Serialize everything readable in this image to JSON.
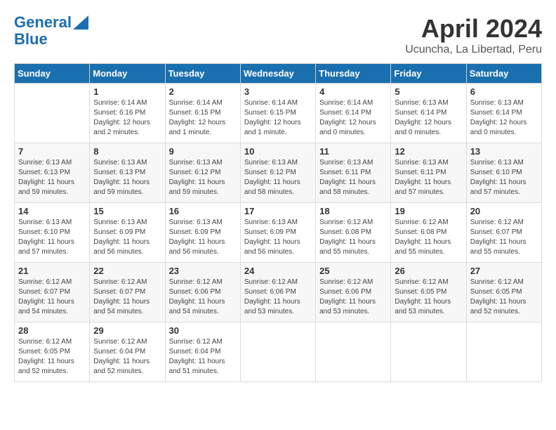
{
  "header": {
    "logo_line1": "General",
    "logo_line2": "Blue",
    "month_title": "April 2024",
    "subtitle": "Ucuncha, La Libertad, Peru"
  },
  "days_of_week": [
    "Sunday",
    "Monday",
    "Tuesday",
    "Wednesday",
    "Thursday",
    "Friday",
    "Saturday"
  ],
  "weeks": [
    [
      {
        "day": "",
        "info": ""
      },
      {
        "day": "1",
        "info": "Sunrise: 6:14 AM\nSunset: 6:16 PM\nDaylight: 12 hours\nand 2 minutes."
      },
      {
        "day": "2",
        "info": "Sunrise: 6:14 AM\nSunset: 6:15 PM\nDaylight: 12 hours\nand 1 minute."
      },
      {
        "day": "3",
        "info": "Sunrise: 6:14 AM\nSunset: 6:15 PM\nDaylight: 12 hours\nand 1 minute."
      },
      {
        "day": "4",
        "info": "Sunrise: 6:14 AM\nSunset: 6:14 PM\nDaylight: 12 hours\nand 0 minutes."
      },
      {
        "day": "5",
        "info": "Sunrise: 6:13 AM\nSunset: 6:14 PM\nDaylight: 12 hours\nand 0 minutes."
      },
      {
        "day": "6",
        "info": "Sunrise: 6:13 AM\nSunset: 6:14 PM\nDaylight: 12 hours\nand 0 minutes."
      }
    ],
    [
      {
        "day": "7",
        "info": "Sunrise: 6:13 AM\nSunset: 6:13 PM\nDaylight: 11 hours\nand 59 minutes."
      },
      {
        "day": "8",
        "info": "Sunrise: 6:13 AM\nSunset: 6:13 PM\nDaylight: 11 hours\nand 59 minutes."
      },
      {
        "day": "9",
        "info": "Sunrise: 6:13 AM\nSunset: 6:12 PM\nDaylight: 11 hours\nand 59 minutes."
      },
      {
        "day": "10",
        "info": "Sunrise: 6:13 AM\nSunset: 6:12 PM\nDaylight: 11 hours\nand 58 minutes."
      },
      {
        "day": "11",
        "info": "Sunrise: 6:13 AM\nSunset: 6:11 PM\nDaylight: 11 hours\nand 58 minutes."
      },
      {
        "day": "12",
        "info": "Sunrise: 6:13 AM\nSunset: 6:11 PM\nDaylight: 11 hours\nand 57 minutes."
      },
      {
        "day": "13",
        "info": "Sunrise: 6:13 AM\nSunset: 6:10 PM\nDaylight: 11 hours\nand 57 minutes."
      }
    ],
    [
      {
        "day": "14",
        "info": "Sunrise: 6:13 AM\nSunset: 6:10 PM\nDaylight: 11 hours\nand 57 minutes."
      },
      {
        "day": "15",
        "info": "Sunrise: 6:13 AM\nSunset: 6:09 PM\nDaylight: 11 hours\nand 56 minutes."
      },
      {
        "day": "16",
        "info": "Sunrise: 6:13 AM\nSunset: 6:09 PM\nDaylight: 11 hours\nand 56 minutes."
      },
      {
        "day": "17",
        "info": "Sunrise: 6:13 AM\nSunset: 6:09 PM\nDaylight: 11 hours\nand 56 minutes."
      },
      {
        "day": "18",
        "info": "Sunrise: 6:12 AM\nSunset: 6:08 PM\nDaylight: 11 hours\nand 55 minutes."
      },
      {
        "day": "19",
        "info": "Sunrise: 6:12 AM\nSunset: 6:08 PM\nDaylight: 11 hours\nand 55 minutes."
      },
      {
        "day": "20",
        "info": "Sunrise: 6:12 AM\nSunset: 6:07 PM\nDaylight: 11 hours\nand 55 minutes."
      }
    ],
    [
      {
        "day": "21",
        "info": "Sunrise: 6:12 AM\nSunset: 6:07 PM\nDaylight: 11 hours\nand 54 minutes."
      },
      {
        "day": "22",
        "info": "Sunrise: 6:12 AM\nSunset: 6:07 PM\nDaylight: 11 hours\nand 54 minutes."
      },
      {
        "day": "23",
        "info": "Sunrise: 6:12 AM\nSunset: 6:06 PM\nDaylight: 11 hours\nand 54 minutes."
      },
      {
        "day": "24",
        "info": "Sunrise: 6:12 AM\nSunset: 6:06 PM\nDaylight: 11 hours\nand 53 minutes."
      },
      {
        "day": "25",
        "info": "Sunrise: 6:12 AM\nSunset: 6:06 PM\nDaylight: 11 hours\nand 53 minutes."
      },
      {
        "day": "26",
        "info": "Sunrise: 6:12 AM\nSunset: 6:05 PM\nDaylight: 11 hours\nand 53 minutes."
      },
      {
        "day": "27",
        "info": "Sunrise: 6:12 AM\nSunset: 6:05 PM\nDaylight: 11 hours\nand 52 minutes."
      }
    ],
    [
      {
        "day": "28",
        "info": "Sunrise: 6:12 AM\nSunset: 6:05 PM\nDaylight: 11 hours\nand 52 minutes."
      },
      {
        "day": "29",
        "info": "Sunrise: 6:12 AM\nSunset: 6:04 PM\nDaylight: 11 hours\nand 52 minutes."
      },
      {
        "day": "30",
        "info": "Sunrise: 6:12 AM\nSunset: 6:04 PM\nDaylight: 11 hours\nand 51 minutes."
      },
      {
        "day": "",
        "info": ""
      },
      {
        "day": "",
        "info": ""
      },
      {
        "day": "",
        "info": ""
      },
      {
        "day": "",
        "info": ""
      }
    ]
  ]
}
